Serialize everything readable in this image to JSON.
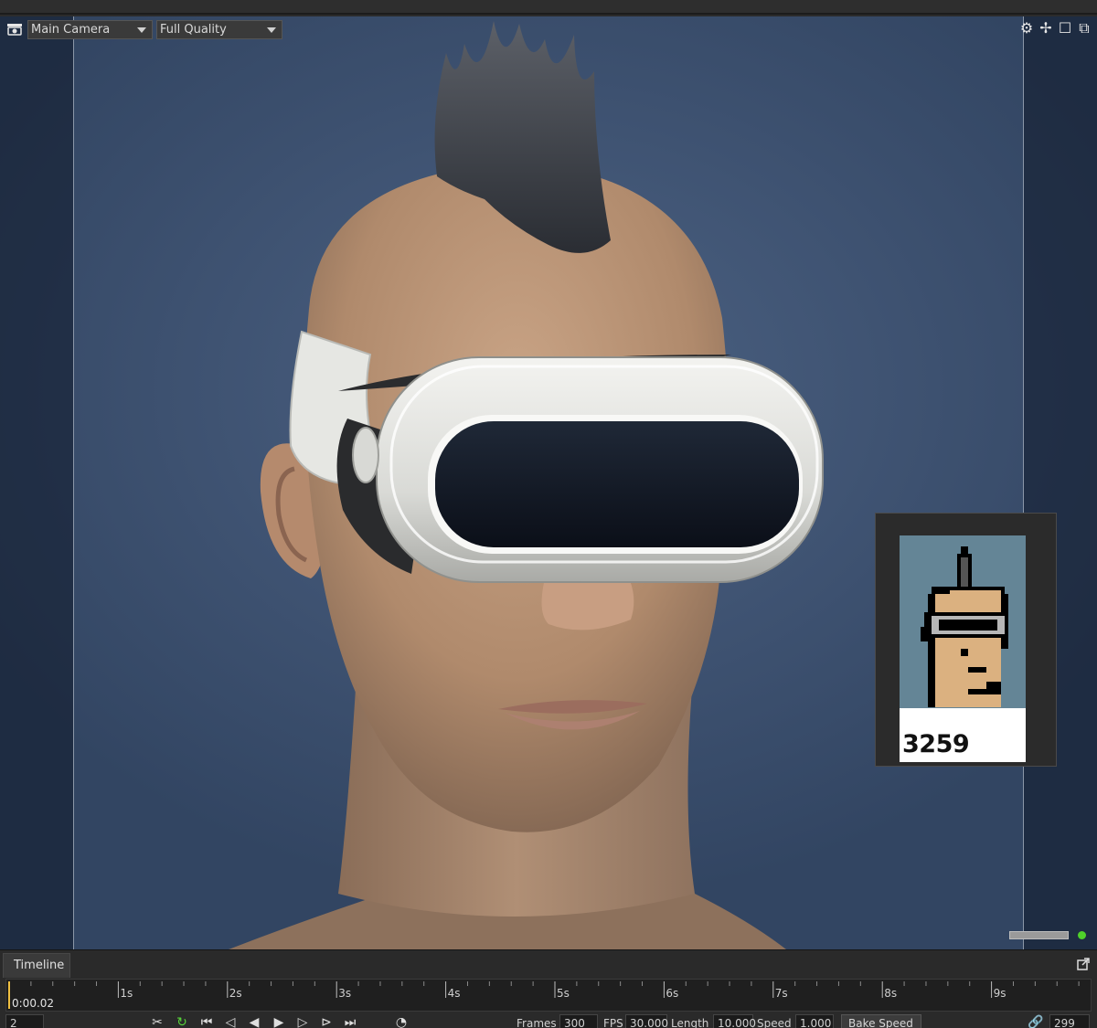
{
  "viewport": {
    "camera_select": "Main Camera",
    "quality_select": "Full Quality",
    "toolbar_icons": [
      "gear-icon",
      "move-icon",
      "maximize-icon",
      "popout-icon"
    ]
  },
  "thumbnail": {
    "number": "3259"
  },
  "timeline": {
    "tab_label": "Timeline",
    "current_time": "0:00.02",
    "ruler_ticks": [
      "1s",
      "2s",
      "3s",
      "4s",
      "5s",
      "6s",
      "7s",
      "8s",
      "9s"
    ],
    "current_frame": "2",
    "frames_label": "Frames",
    "frames_value": "300",
    "fps_label": "FPS",
    "fps_value": "30.000",
    "length_label": "Length",
    "length_value": "10.000",
    "speed_label": "Speed",
    "speed_value": "1.000",
    "bake_label": "Bake Speed",
    "end_frame": "299"
  },
  "colors": {
    "background": "#3e5271",
    "accent_green": "#4fd12a",
    "playhead": "#f0c040"
  }
}
